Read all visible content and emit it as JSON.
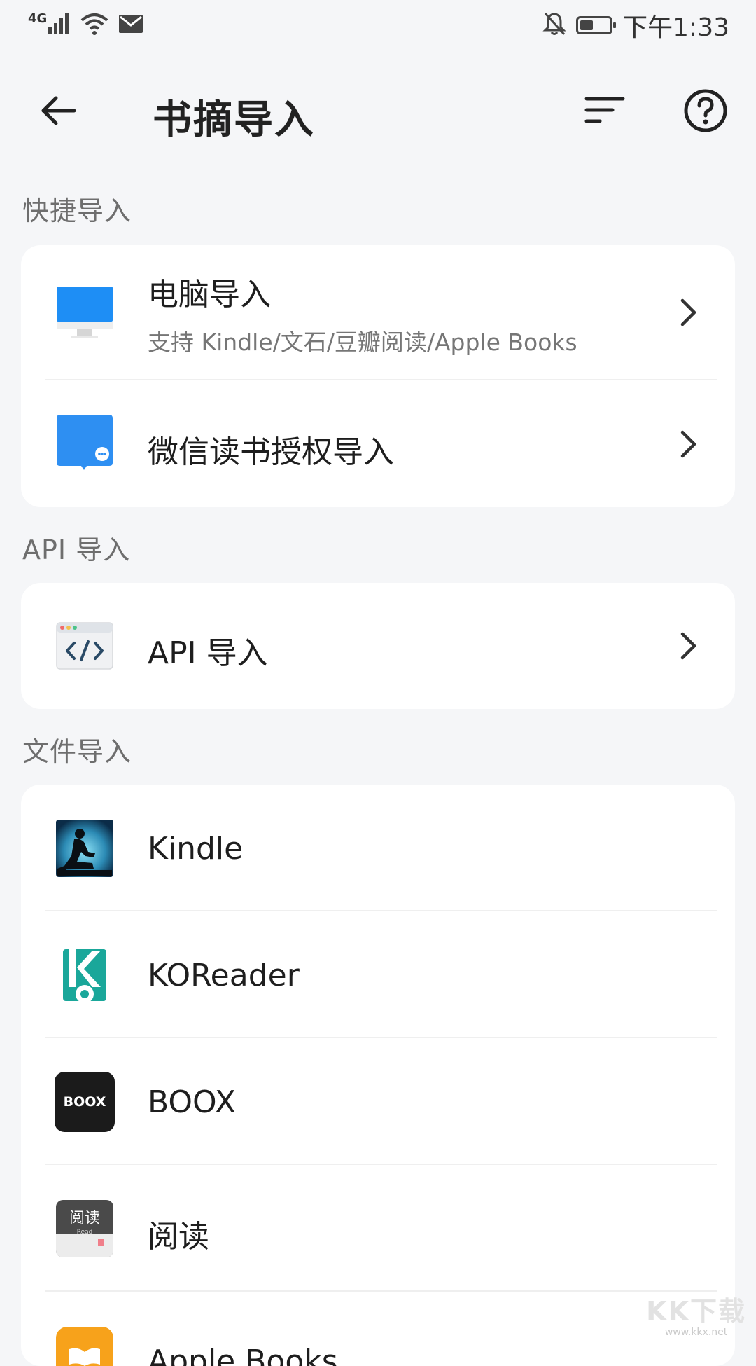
{
  "status_bar": {
    "network_label": "4G",
    "time": "下午1:33",
    "icons": [
      "signal-icon",
      "wifi-icon",
      "mail-icon",
      "silent-bell-icon",
      "battery-icon"
    ],
    "battery_level_percent": 45
  },
  "header": {
    "title": "书摘导入",
    "back_icon": "arrow-left-icon",
    "sort_icon": "sort-icon",
    "help_icon": "help-icon"
  },
  "sections": [
    {
      "title": "快捷导入",
      "items": [
        {
          "title": "电脑导入",
          "subtitle": "支持 Kindle/文石/豆瓣阅读/Apple Books",
          "icon": "computer-icon"
        },
        {
          "title": "微信读书授权导入",
          "icon": "wechat-read-icon"
        }
      ]
    },
    {
      "title": "API 导入",
      "items": [
        {
          "title": "API 导入",
          "icon": "code-window-icon"
        }
      ]
    },
    {
      "title": "文件导入",
      "items": [
        {
          "title": "Kindle",
          "icon": "kindle-icon"
        },
        {
          "title": "KOReader",
          "icon": "koreader-icon"
        },
        {
          "title": "BOOX",
          "icon": "boox-icon",
          "logo_text": "BOOX"
        },
        {
          "title": "阅读",
          "icon": "yuedu-icon",
          "logo_text": "阅读",
          "logo_sub": "Read"
        },
        {
          "title": "Apple Books",
          "icon": "apple-books-icon"
        }
      ]
    }
  ],
  "watermark": {
    "main": "KK下载",
    "sub": "www.kkx.net"
  },
  "colors": {
    "background": "#f5f6f8",
    "card": "#ffffff",
    "section_title": "#6e6e6e",
    "accent_blue": "#1e8ef5",
    "koreader_teal": "#1aa79a",
    "apple_books_orange": "#f7a21b"
  }
}
